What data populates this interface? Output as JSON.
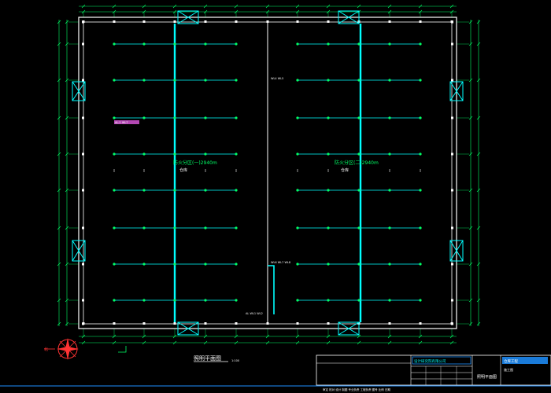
{
  "drawing": {
    "title": "照明平面图",
    "title_scale": "1:100",
    "zone_left_label": "防火分区(一)2940m",
    "zone_right_label": "防火分区(二)2940m",
    "zone_left_sub": "仓库",
    "zone_right_sub": "仓库",
    "left_note": "AL-1 WL7",
    "center_note_top": "WL4 WL5",
    "center_note_bottom": "WL6 WL7 WL8",
    "bottom_note": "AL WL1 WL2",
    "north_label": "北"
  },
  "title_block": {
    "company": "设计研究院有限公司",
    "sheet_name": "照明平面图",
    "project": "仓库工程",
    "stage": "施工图",
    "footer_line": "审定 校对 设计 制图 专业负责 工程负责 图号 比例 日期"
  },
  "colors": {
    "background": "#000000",
    "wall": "#ffffff",
    "wiring": "#00ffff",
    "dimension": "#00ff66",
    "title_bar": "#1e90ff"
  }
}
